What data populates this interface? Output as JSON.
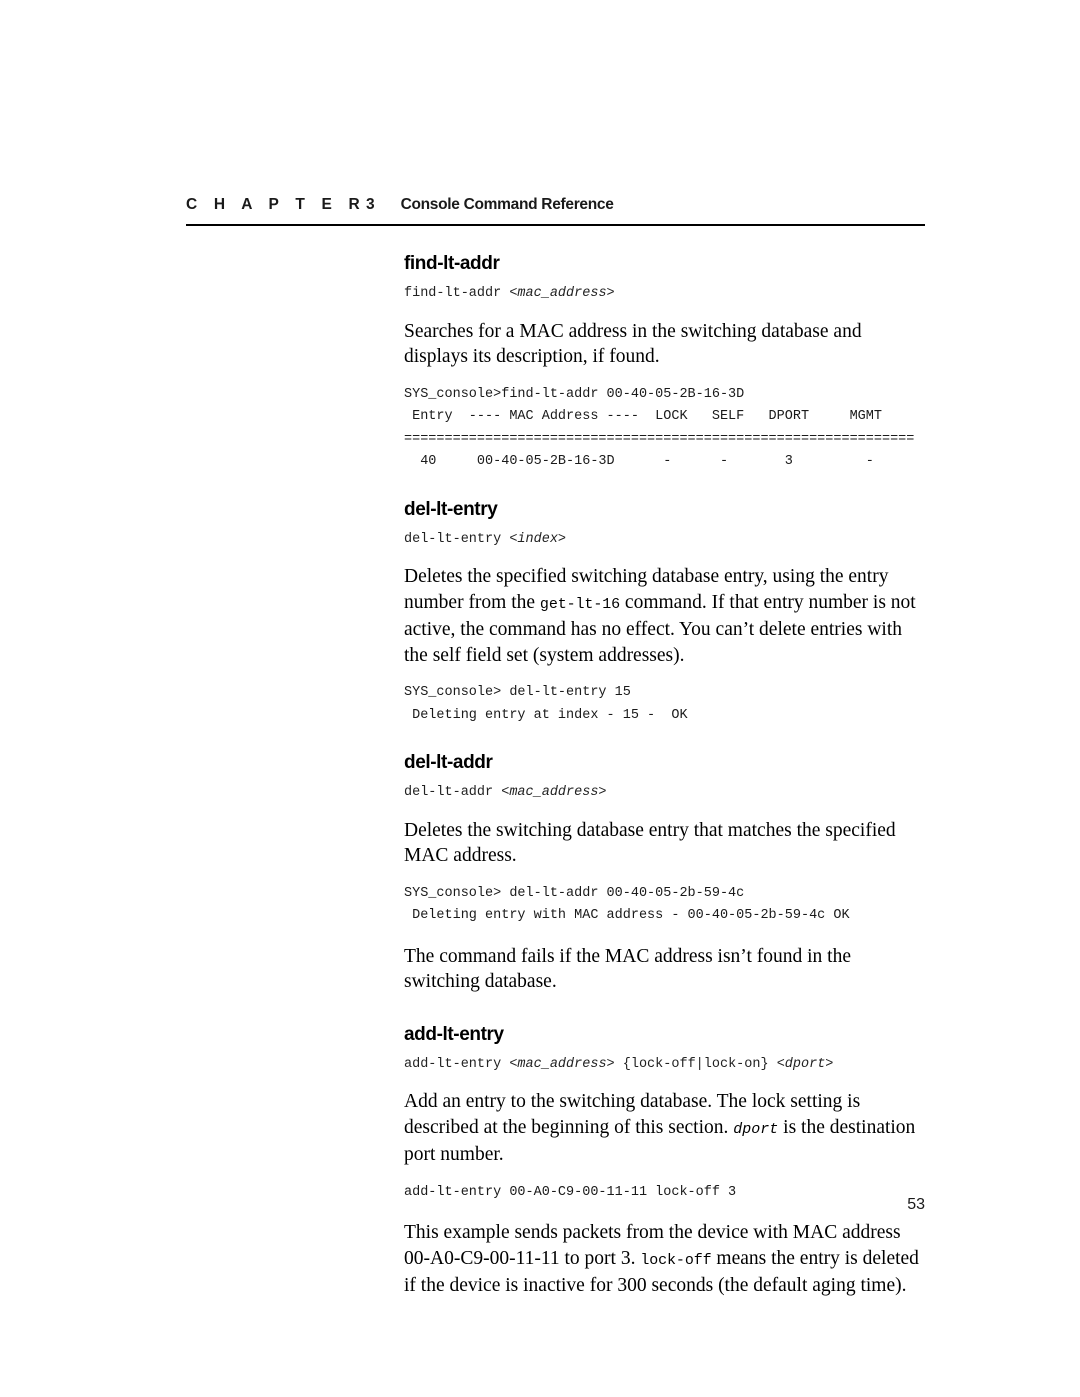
{
  "header": {
    "chapter_word": "C H A P T E R",
    "chapter_number": "3",
    "title": "Console Command Reference"
  },
  "sections": [
    {
      "heading": "find-lt-addr",
      "syntax_prefix": "find-lt-addr ",
      "syntax_arg": "<mac_address>",
      "description": "Searches for a MAC address in the switching database and displays its description, if found.",
      "console": "SYS_console>find-lt-addr 00-40-05-2B-16-3D\n Entry  ---- MAC Address ----  LOCK   SELF   DPORT     MGMT\n===============================================================\n  40     00-40-05-2B-16-3D      -      -       3         -"
    },
    {
      "heading": "del-lt-entry",
      "syntax_prefix": "del-lt-entry ",
      "syntax_arg": "<index>",
      "description_part1": "Deletes the specified switching database entry, using the entry number from the ",
      "description_code": "get-lt-16",
      "description_part2": " command. If that entry number is not active, the command has no effect. You can’t delete entries with the self field set (system addresses).",
      "console": "SYS_console> del-lt-entry 15\n Deleting entry at index - 15 -  OK"
    },
    {
      "heading": "del-lt-addr",
      "syntax_prefix": "del-lt-addr ",
      "syntax_arg": "<mac_address>",
      "description": "Deletes the switching database entry that matches the specified MAC address.",
      "console": "SYS_console> del-lt-addr 00-40-05-2b-59-4c\n Deleting entry with MAC address - 00-40-05-2b-59-4c OK",
      "note": "The command fails if the MAC address isn’t found in the switching database."
    },
    {
      "heading": "add-lt-entry",
      "syntax_cmd": "add-lt-entry ",
      "syntax_arg1": "<mac_address>",
      "syntax_mid": " {lock-off|lock-on} ",
      "syntax_arg2": "<dport>",
      "description_part1": "Add an entry to the switching database. The lock setting is described at the beginning of this section. ",
      "description_code": "dport",
      "description_part2": " is the destination port number.",
      "console": "add-lt-entry 00-A0-C9-00-11-11 lock-off 3",
      "closing_part1": "This example sends packets from the device with MAC address 00-A0-C9-00-11-11 to port 3. ",
      "closing_code": "lock-off",
      "closing_part2": " means the entry is deleted if the device is inactive for 300 seconds (the default aging time)."
    }
  ],
  "folio": {
    "page_number": "53"
  }
}
